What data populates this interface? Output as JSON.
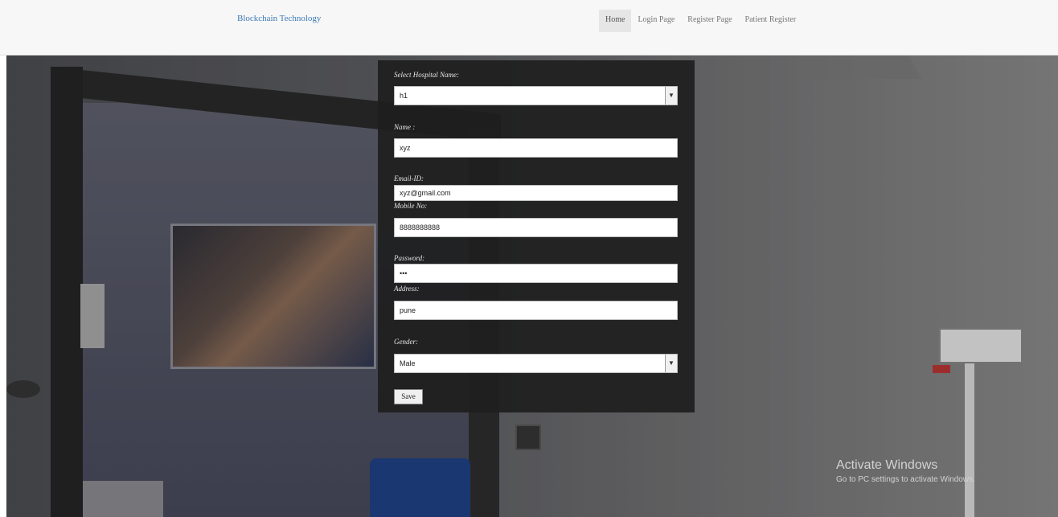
{
  "navbar": {
    "brand": "Blockchain Technology",
    "items": [
      {
        "label": "Home"
      },
      {
        "label": "Login Page"
      },
      {
        "label": "Register Page"
      },
      {
        "label": "Patient Register"
      }
    ]
  },
  "form": {
    "hospital_label": "Select Hospital Name:",
    "hospital_value": "h1",
    "name_label": "Name :",
    "name_value": "xyz",
    "email_label": "Email-ID:",
    "email_value": "xyz@gmail.com",
    "mobile_label": "Mobile No:",
    "mobile_value": "8888888888",
    "password_label": "Password:",
    "password_value": "•••",
    "address_label": "Address:",
    "address_value": "pune",
    "gender_label": "Gender:",
    "gender_value": "Male",
    "save_label": "Save"
  },
  "watermark": {
    "title": "Activate Windows",
    "subtitle": "Go to PC settings to activate Windows."
  },
  "icons": {
    "select_arrow": "chevron-down-icon"
  }
}
